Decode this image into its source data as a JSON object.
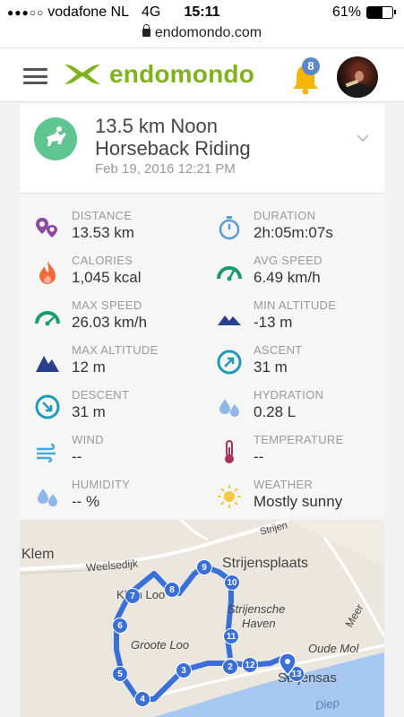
{
  "status_bar": {
    "carrier": "vodafone NL",
    "network": "4G",
    "time": "15:11",
    "battery": "61%",
    "battery_level": 0.61
  },
  "url_bar": {
    "url": "endomondo.com"
  },
  "header": {
    "logo_text": "endomondo",
    "notification_count": "8",
    "brand_color": "#7fb21c",
    "bell_color": "#f5b400",
    "badge_color": "#5b89c8"
  },
  "workout": {
    "title_line1": "13.5 km Noon",
    "title_line2": "Horseback Riding",
    "date": "Feb 19, 2016 12:21 PM",
    "sport_icon_color": "#5fc691"
  },
  "stats": [
    {
      "label": "DISTANCE",
      "value": "13.53 km",
      "icon": "distance-pins-icon"
    },
    {
      "label": "DURATION",
      "value": "2h:05m:07s",
      "icon": "stopwatch-icon"
    },
    {
      "label": "CALORIES",
      "value": "1,045 kcal",
      "icon": "flame-icon"
    },
    {
      "label": "AVG SPEED",
      "value": "6.49 km/h",
      "icon": "speedometer-icon"
    },
    {
      "label": "MAX SPEED",
      "value": "26.03 km/h",
      "icon": "speedometer-icon"
    },
    {
      "label": "MIN ALTITUDE",
      "value": "-13 m",
      "icon": "low-mountain-icon"
    },
    {
      "label": "MAX ALTITUDE",
      "value": "12 m",
      "icon": "mountain-icon"
    },
    {
      "label": "ASCENT",
      "value": "31 m",
      "icon": "ascent-arrow-icon"
    },
    {
      "label": "DESCENT",
      "value": "31 m",
      "icon": "descent-arrow-icon"
    },
    {
      "label": "HYDRATION",
      "value": "0.28 L",
      "icon": "water-drops-icon"
    },
    {
      "label": "WIND",
      "value": "--",
      "icon": "wind-icon"
    },
    {
      "label": "TEMPERATURE",
      "value": "--",
      "icon": "thermometer-icon"
    },
    {
      "label": "HUMIDITY",
      "value": "-- %",
      "icon": "humidity-drops-icon"
    },
    {
      "label": "WEATHER",
      "value": "Mostly sunny",
      "icon": "sun-icon"
    }
  ],
  "map": {
    "labels": [
      "Klem",
      "Weelsedijk",
      "Strijen",
      "Strijensche",
      "Haven",
      "Groote Loo",
      "Oude Mol",
      "Meer",
      "Diep",
      "Klein Loo",
      "Strijensas",
      "Strijensplaats"
    ],
    "km_markers": [
      "2",
      "3",
      "4",
      "5",
      "6",
      "7",
      "8",
      "9",
      "10",
      "11",
      "12",
      "13"
    ],
    "route_color": "#3a6fd8",
    "water_color": "#a6c7f0"
  }
}
